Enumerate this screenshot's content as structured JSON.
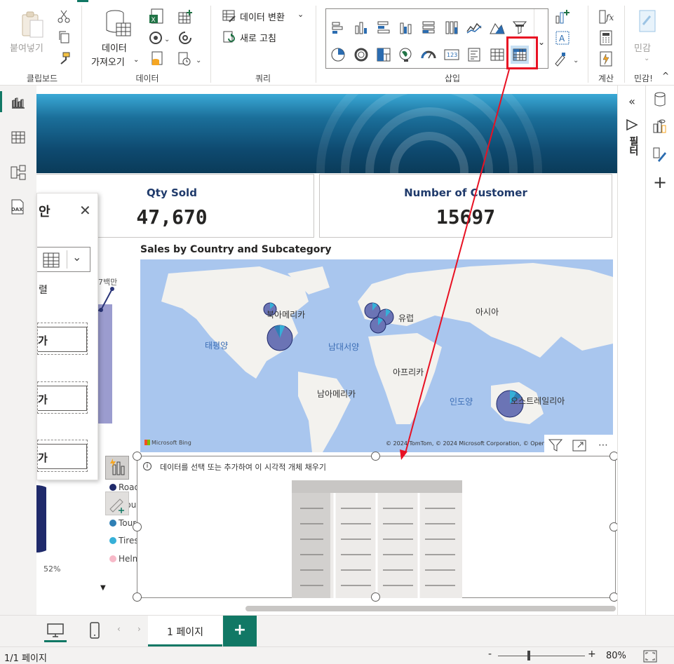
{
  "ribbon": {
    "clipboard": {
      "paste_label": "붙여넣기",
      "group_label": "클립보드"
    },
    "data": {
      "get_data_label_line1": "데이터",
      "get_data_label_line2": "가져오기",
      "group_label": "데이터"
    },
    "query": {
      "transform_label": "데이터 변환",
      "refresh_label": "새로 고침",
      "group_label": "쿼리"
    },
    "insert": {
      "group_label": "삽입"
    },
    "calc": {
      "group_label": "계산"
    },
    "sensitivity": {
      "label": "민감",
      "group_label": "민감!"
    }
  },
  "left_rail": {
    "items": [
      "report-view-icon",
      "table-view-icon",
      "model-view-icon",
      "dax-query-icon"
    ],
    "dax_text": "DAX"
  },
  "pane": {
    "title": "안",
    "axis_label": "렬",
    "add1": "가",
    "add2": "가",
    "add3": "가"
  },
  "filter_pane": {
    "label": "필터"
  },
  "cards": [
    {
      "title": "Qty Sold",
      "value": "47,670"
    },
    {
      "title": "Number of Customer",
      "value": "15697"
    }
  ],
  "map": {
    "title": "Sales by Country and Subcategory",
    "labels": {
      "north_america": "북아메리카",
      "europe": "유럽",
      "asia": "아시아",
      "pacific": "태평양",
      "atlantic": "남대서양",
      "africa": "아프리카",
      "south_america": "남아메리카",
      "indian": "인도양",
      "australia": "오스트레일리아"
    },
    "bing": "Microsoft Bing",
    "copyright": "© 2024 TomTom, © 2024 Microsoft Corporation, © OpenS"
  },
  "partial_chart": {
    "value_label": "7백만",
    "percent_label": "52%"
  },
  "legend": [
    {
      "label": "Road Bikes",
      "color": "#1f2a6b"
    },
    {
      "label": "Moun",
      "color": "#1f2a6b"
    },
    {
      "label": "Touring ...",
      "color": "#2f7fb5"
    },
    {
      "label": "Tires and...",
      "color": "#36b0d8"
    },
    {
      "label": "Helmets",
      "color": "#f7b9c8"
    }
  ],
  "table_visual": {
    "hint": "데이터를 선택 또는 추가하여 이 시각적 개체 채우기"
  },
  "tabs": {
    "page1": "1 페이지",
    "add": "+"
  },
  "status": {
    "page_indicator": "1/1 페이지",
    "zoom": "80%",
    "zoom_minus": "-",
    "zoom_plus": "+"
  },
  "colors": {
    "accent": "#117865",
    "highlight": "#e81123",
    "arrow": "#e81123"
  }
}
